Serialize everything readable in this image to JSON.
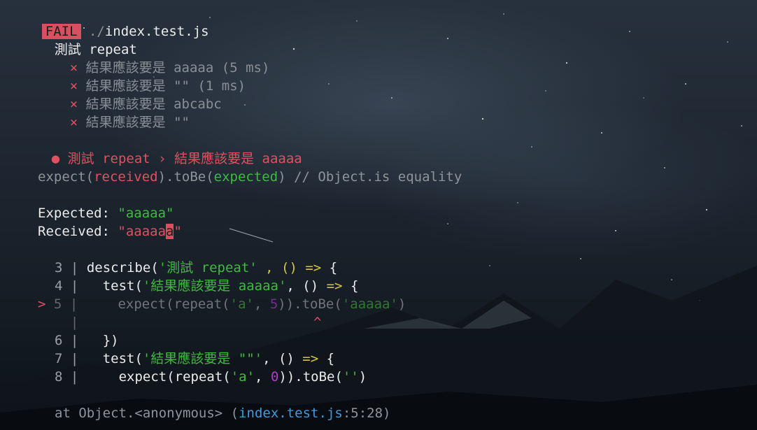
{
  "header": {
    "badge": "FAIL",
    "file_prefix": " ./",
    "file_name": "index.test.js"
  },
  "suite": {
    "name": "測試 repeat",
    "tests": [
      {
        "status_icon": "×",
        "label": "結果應該要是 aaaaa",
        "duration": "(5 ms)"
      },
      {
        "status_icon": "×",
        "label": "結果應該要是 \"\"",
        "duration": "(1 ms)"
      },
      {
        "status_icon": "×",
        "label": "結果應該要是 abcabc",
        "duration": ""
      },
      {
        "status_icon": "×",
        "label": "結果應該要是 \"\"",
        "duration": ""
      }
    ]
  },
  "failure": {
    "bullet": "●",
    "suite": "測試 repeat",
    "separator": "›",
    "test": "結果應該要是 aaaaa",
    "matcher": {
      "expect": "expect(",
      "received": "received",
      "tobe": ").toBe(",
      "expected": "expected",
      "close": ")",
      "comment": " // Object.is equality"
    },
    "expected_label": "Expected: ",
    "expected_value": "\"aaaaa\"",
    "received_label": "Received: ",
    "received_prefix": "\"aaaaa",
    "received_highlight": "a",
    "received_suffix": "\""
  },
  "code_frame": {
    "lines": [
      {
        "num": "3",
        "code_a": "describe(",
        "str": "'測試 repeat'",
        "code_b": " , () ",
        "arrow": "=>",
        "code_c": " {"
      },
      {
        "num": "4",
        "code_a": "  test(",
        "str": "'結果應該要是 aaaaa'",
        "code_b": ", () ",
        "arrow": "=>",
        "code_c": " {"
      },
      {
        "num": "5",
        "marker": ">",
        "code_a": "    expect(repeat(",
        "str1": "'a'",
        "sep": ", ",
        "num_lit": "5",
        "code_b": ")).toBe(",
        "str2": "'aaaaa'",
        "code_c": ")"
      },
      {
        "caret": "^"
      },
      {
        "num": "6",
        "code_a": "  })"
      },
      {
        "num": "7",
        "code_a": "  test(",
        "str": "'結果應該要是 \"\"'",
        "code_b": ", () ",
        "arrow": "=>",
        "code_c": " {"
      },
      {
        "num": "8",
        "code_a": "    expect(repeat(",
        "str1": "'a'",
        "sep": ", ",
        "num_lit": "0",
        "code_b": ")).toBe(",
        "str2": "''",
        "code_c": ")"
      }
    ],
    "pipe": "|"
  },
  "stack": {
    "prefix": "at Object.<anonymous> (",
    "file": "index.test.js",
    "location": ":5:28)"
  }
}
